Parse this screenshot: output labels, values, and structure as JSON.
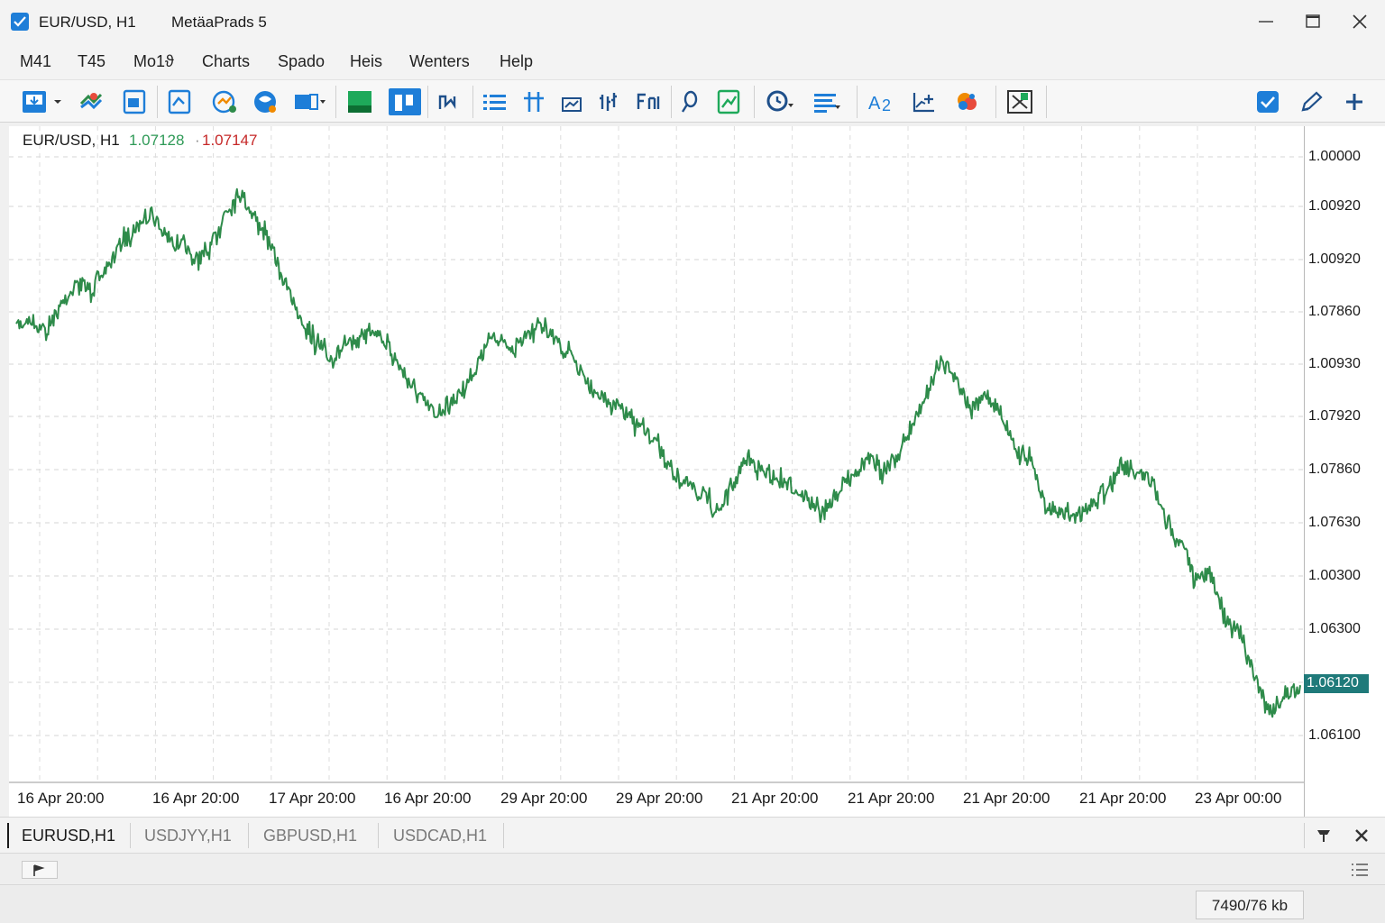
{
  "window": {
    "title": "EUR/USD, H1",
    "app_name": "MetäaPrads 5"
  },
  "menu": [
    "M41",
    "T45",
    "Mo1ϑ",
    "Charts",
    "Spado",
    "Heis",
    "Wenters",
    "Help"
  ],
  "toolbar": {
    "buttons": [
      "new-chart-icon",
      "dropdown-arrow-icon",
      "profiles-icon",
      "open-file-icon",
      "templates-icon",
      "market-watch-icon",
      "navigator-icon",
      "data-window-icon",
      "bar-chart-icon",
      "candlestick-icon",
      "line-chart-icon",
      "indicators-list-icon",
      "crosshair-icon",
      "period-icon",
      "bars-icon",
      "cursor-icon",
      "zoom-icon",
      "trade-icon",
      "clock-icon",
      "list-icon",
      "text-icon",
      "trendline-icon",
      "colors-icon",
      "screenshot-icon",
      "checkbox-icon",
      "pen-icon",
      "plus-icon"
    ],
    "accent": "#1e7ed8"
  },
  "chart": {
    "symbol": "EUR/USD, H1",
    "bid": "1.07128",
    "separator": "·",
    "ask": "1.07147",
    "current_price": "1.06120",
    "line_color": "#2e8b4a",
    "grid": "dashed"
  },
  "chart_data": {
    "type": "line",
    "y_tick_labels": [
      "1.00000",
      "1.00920",
      "1.00920",
      "1.07860",
      "1.00930",
      "1.07920",
      "1.07860",
      "1.07630",
      "1.00300",
      "1.06300",
      "1.06120",
      "1.06100"
    ],
    "x_tick_labels": [
      "16 Apr 20:00",
      "16 Apr 20:00",
      "17 Apr 20:00",
      "16 Apr 20:00",
      "29 Apr 20:00",
      "29 Apr 20:00",
      "21 Apr 20:00",
      "21 Apr 20:00",
      "21 Apr 20:00",
      "21 Apr 20:00",
      "23 Apr 00:00"
    ],
    "ylim": [
      1.0603,
      1.0785
    ],
    "series": [
      {
        "values": [
          1.0735,
          1.0737,
          1.0733,
          1.0741,
          1.0748,
          1.0746,
          1.0752,
          1.076,
          1.0765,
          1.077,
          1.0762,
          1.076,
          1.0755,
          1.0758,
          1.077,
          1.0776,
          1.0768,
          1.076,
          1.0748,
          1.0738,
          1.073,
          1.0725,
          1.0728,
          1.0731,
          1.0735,
          1.0728,
          1.072,
          1.0713,
          1.0708,
          1.0711,
          1.0716,
          1.0724,
          1.0733,
          1.0727,
          1.0731,
          1.0736,
          1.0731,
          1.0726,
          1.072,
          1.0714,
          1.0711,
          1.0707,
          1.0703,
          1.0698,
          1.069,
          1.0686,
          1.0683,
          1.0678,
          1.0686,
          1.0695,
          1.069,
          1.0688,
          1.0686,
          1.0682,
          1.0677,
          1.0684,
          1.069,
          1.0694,
          1.0691,
          1.0695,
          1.0704,
          1.0714,
          1.0725,
          1.0719,
          1.0709,
          1.0714,
          1.0708,
          1.0697,
          1.0693,
          1.0679,
          1.0678,
          1.0676,
          1.0681,
          1.0685,
          1.0692,
          1.0689,
          1.0688,
          1.0675,
          1.0669,
          1.0657,
          1.0659,
          1.0646,
          1.064,
          1.0627,
          1.0617,
          1.0622,
          1.0625
        ]
      }
    ]
  },
  "tabs": [
    "EURUSD,H1",
    "USDJYY,H1",
    "GBPUSD,H1",
    "USDCAD,H1"
  ],
  "status": {
    "memory": "7490/76 kb"
  }
}
